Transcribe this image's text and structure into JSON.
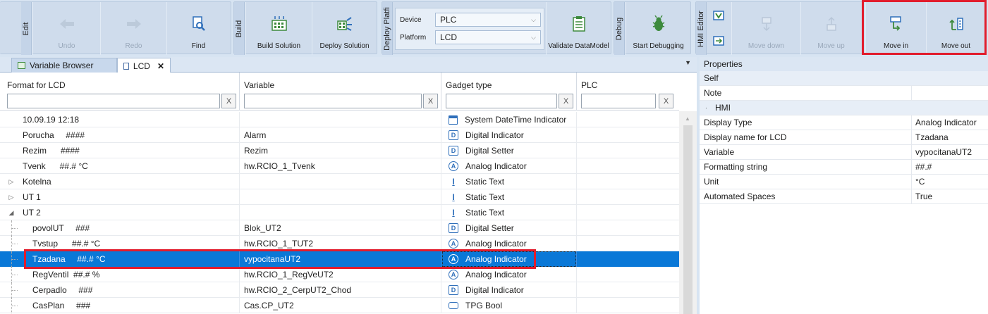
{
  "ribbon": {
    "groups": {
      "edit": "Edit",
      "build": "Build",
      "deploy": "Deploy Platfi",
      "debug": "Debug",
      "hmi": "HMI Editor"
    },
    "buttons": {
      "undo": "Undo",
      "redo": "Redo",
      "find": "Find",
      "build_solution": "Build Solution",
      "deploy_solution": "Deploy Solution",
      "validate": "Validate DataModel",
      "start_debugging": "Start Debugging",
      "move_down": "Move down",
      "move_up": "Move up",
      "move_in": "Move in",
      "move_out": "Move out"
    },
    "device_label": "Device",
    "device_value": "PLC",
    "platform_label": "Platform",
    "platform_value": "LCD"
  },
  "tabs": [
    {
      "label": "Variable Browser",
      "active": false
    },
    {
      "label": "LCD",
      "active": true
    }
  ],
  "grid": {
    "columns": [
      "Format for LCD",
      "Variable",
      "Gadget type",
      "PLC"
    ],
    "clear_label": "X",
    "rows": [
      {
        "format": "10.09.19 12:18",
        "variable": "",
        "gadget": "System DateTime Indicator",
        "icon": "calendar-icon",
        "level": 0,
        "expander": ""
      },
      {
        "format": "Porucha     ####",
        "variable": "Alarm",
        "gadget": "Digital Indicator",
        "icon": "digital-indicator-icon",
        "level": 0,
        "expander": ""
      },
      {
        "format": "Rezim      ####",
        "variable": "Rezim",
        "gadget": "Digital Setter",
        "icon": "digital-setter-icon",
        "level": 0,
        "expander": ""
      },
      {
        "format": "Tvenk      ##.# °C",
        "variable": "hw.RCIO_1_Tvenk",
        "gadget": "Analog Indicator",
        "icon": "analog-indicator-icon",
        "level": 0,
        "expander": ""
      },
      {
        "format": "Kotelna",
        "variable": "",
        "gadget": "Static Text",
        "icon": "static-text-icon",
        "level": 0,
        "expander": "▷"
      },
      {
        "format": "UT 1",
        "variable": "",
        "gadget": "Static Text",
        "icon": "static-text-icon",
        "level": 0,
        "expander": "▷"
      },
      {
        "format": "UT 2",
        "variable": "",
        "gadget": "Static Text",
        "icon": "static-text-icon",
        "level": 0,
        "expander": "◢"
      },
      {
        "format": "povolUT     ###",
        "variable": "Blok_UT2",
        "gadget": "Digital Setter",
        "icon": "digital-setter-icon",
        "level": 1,
        "expander": ""
      },
      {
        "format": "Tvstup      ##.# °C",
        "variable": "hw.RCIO_1_TUT2",
        "gadget": "Analog Indicator",
        "icon": "analog-indicator-icon",
        "level": 1,
        "expander": ""
      },
      {
        "format": "Tzadana     ##.# °C",
        "variable": "vypocitanaUT2",
        "gadget": "Analog Indicator",
        "icon": "analog-indicator-icon",
        "level": 1,
        "expander": "",
        "selected": true
      },
      {
        "format": "RegVentil  ##.# %",
        "variable": "hw.RCIO_1_RegVeUT2",
        "gadget": "Analog Indicator",
        "icon": "analog-indicator-icon",
        "level": 1,
        "expander": ""
      },
      {
        "format": "Cerpadlo     ###",
        "variable": "hw.RCIO_2_CerpUT2_Chod",
        "gadget": "Digital Indicator",
        "icon": "digital-indicator-icon",
        "level": 1,
        "expander": ""
      },
      {
        "format": "CasPlan     ###",
        "variable": "Cas.CP_UT2",
        "gadget": "TPG Bool",
        "icon": "tpg-bool-icon",
        "level": 1,
        "expander": ""
      }
    ]
  },
  "properties": {
    "title": "Properties",
    "rows": [
      {
        "name": "Self",
        "value": "",
        "section": true
      },
      {
        "name": "Note",
        "value": "",
        "section": false
      },
      {
        "name": "HMI",
        "value": "",
        "section": true,
        "category": true
      },
      {
        "name": "Display Type",
        "value": "Analog Indicator",
        "section": false
      },
      {
        "name": "Display name for LCD",
        "value": "Tzadana",
        "section": false
      },
      {
        "name": "Variable",
        "value": "vypocitanaUT2",
        "section": false
      },
      {
        "name": "Formatting string",
        "value": "##.#",
        "section": false
      },
      {
        "name": "Unit",
        "value": "°C",
        "section": false
      },
      {
        "name": "Automated Spaces",
        "value": "True",
        "section": false
      }
    ]
  },
  "colors": {
    "selection": "#0a78d7",
    "highlight": "#e21c2c",
    "ribbon": "#d7e4f2"
  }
}
